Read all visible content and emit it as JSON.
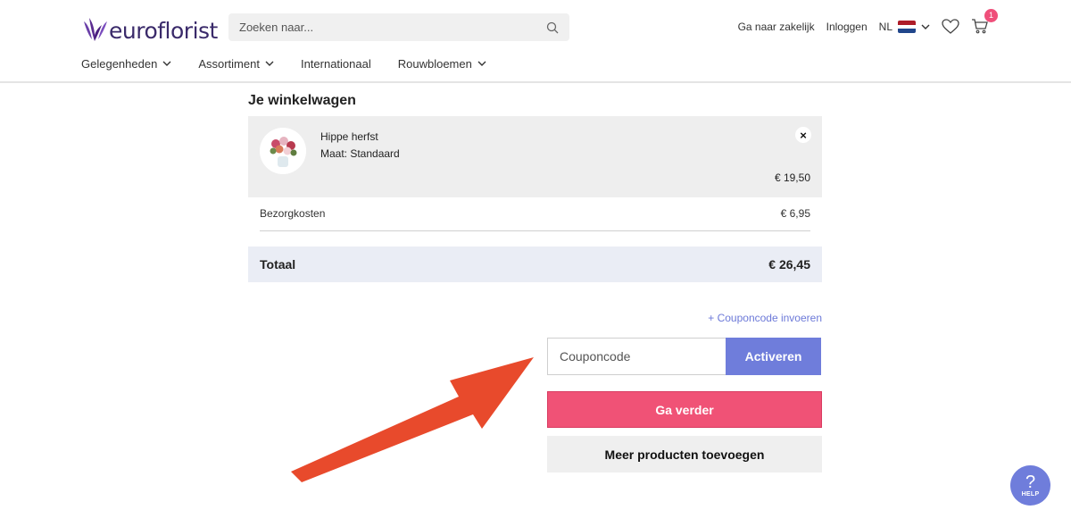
{
  "header": {
    "logo_text": "euroflorist",
    "search_placeholder": "Zoeken naar...",
    "links": {
      "business": "Ga naar zakelijk",
      "login": "Inloggen",
      "language": "NL",
      "cart_count": "1"
    },
    "nav": [
      "Gelegenheden",
      "Assortiment",
      "Internationaal",
      "Rouwbloemen"
    ]
  },
  "cart": {
    "title": "Je winkelwagen",
    "item": {
      "name": "Hippe herfst",
      "size": "Maat: Standaard",
      "price": "€ 19,50",
      "remove": "×"
    },
    "shipping": {
      "label": "Bezorgkosten",
      "value": "€ 6,95"
    },
    "total": {
      "label": "Totaal",
      "value": "€ 26,45"
    },
    "coupon_link": "+ Couponcode invoeren",
    "coupon_placeholder": "Couponcode",
    "coupon_button": "Activeren",
    "continue_button": "Ga verder",
    "add_more_button": "Meer producten toevoegen"
  },
  "help": {
    "icon": "?",
    "label": "HELP"
  },
  "colors": {
    "accent": "#6f7ddb",
    "primary_button": "#f05276",
    "arrow": "#e84a2c",
    "brand": "#5c2d91"
  }
}
